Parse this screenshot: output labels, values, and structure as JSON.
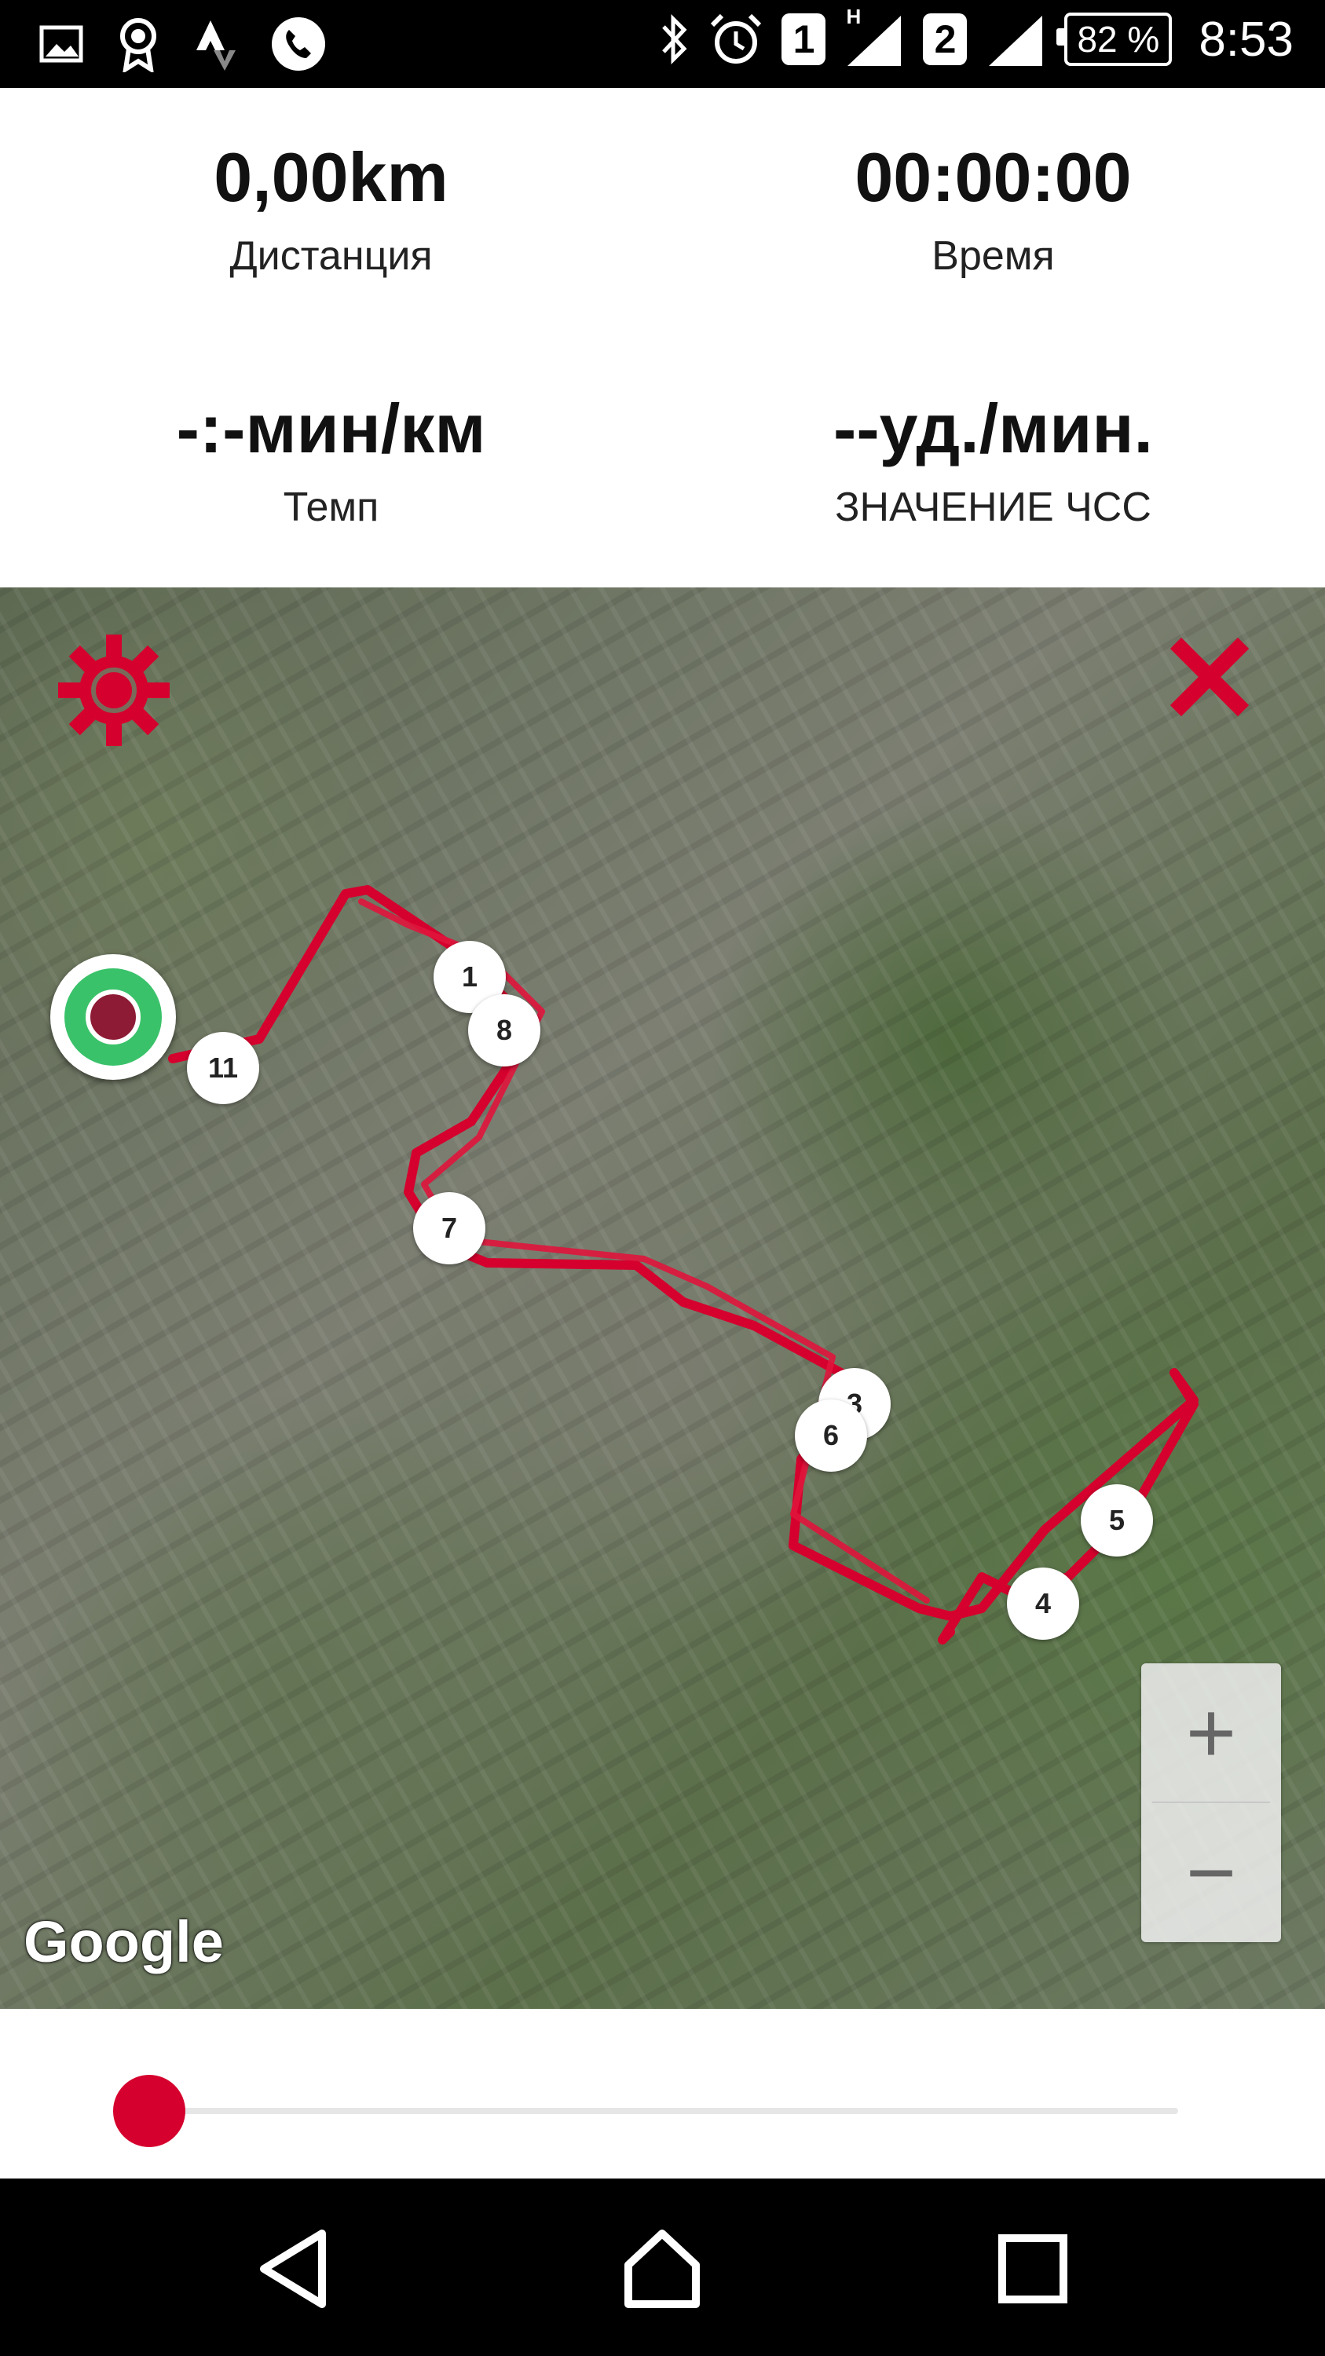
{
  "status_bar": {
    "icons_left": [
      "gallery-icon",
      "award-icon",
      "strava-icon",
      "phone-icon"
    ],
    "icons_right": [
      "bluetooth-icon",
      "alarm-icon"
    ],
    "sim1": "1",
    "sim2": "2",
    "network_type": "H",
    "battery": "82 %",
    "time": "8:53"
  },
  "stats": {
    "distance": {
      "value": "0,00km",
      "label": "Дистанция"
    },
    "time": {
      "value": "00:00:00",
      "label": "Время"
    },
    "pace": {
      "value": "-:-мин/км",
      "label": "Темп"
    },
    "heart_rate": {
      "value": "--уд./мин.",
      "label": "ЗНАЧЕНИЕ ЧСС"
    }
  },
  "map": {
    "attribution": "Google",
    "route_color": "#d5002d",
    "markers": [
      "1",
      "8",
      "11",
      "7",
      "3",
      "6",
      "5",
      "4"
    ],
    "zoom_in": "+",
    "zoom_out": "−"
  },
  "slider": {
    "progress": 0.0,
    "accent": "#d5002d"
  },
  "nav": {
    "icons": [
      "back-icon",
      "home-icon",
      "recents-icon"
    ]
  }
}
